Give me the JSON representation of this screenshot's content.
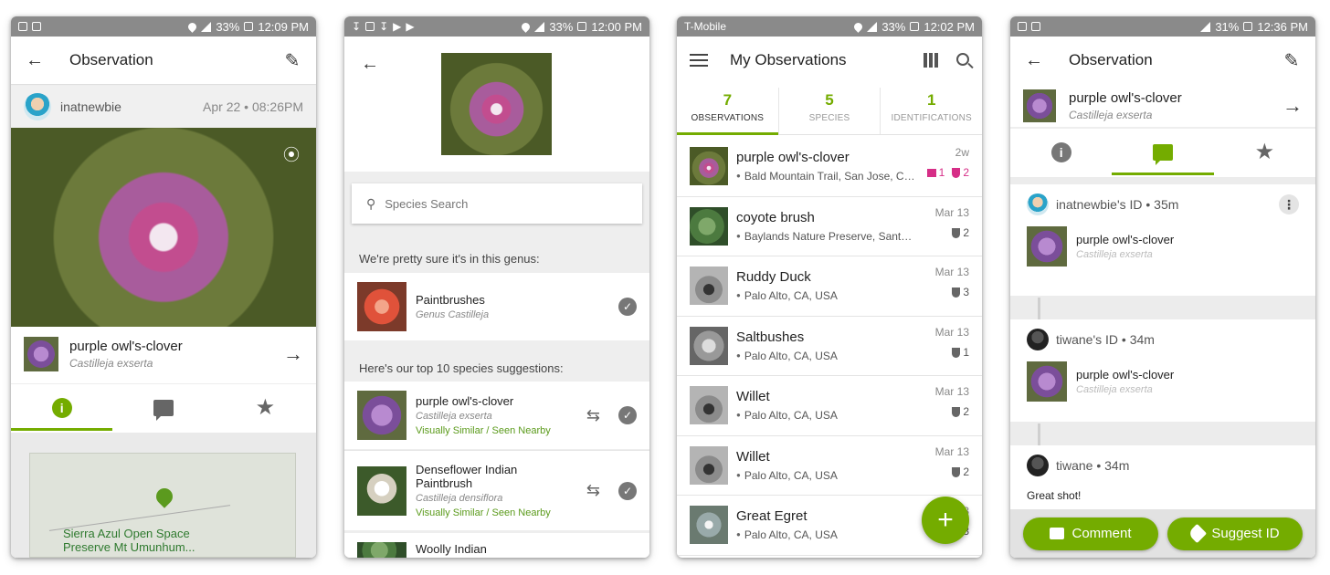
{
  "screen1": {
    "status": {
      "left_icons": [
        "image-icon",
        "gallery-icon"
      ],
      "battery": "33%",
      "time": "12:09 PM"
    },
    "appbar": {
      "title": "Observation"
    },
    "user": {
      "name": "inatnewbie",
      "date": "Apr 22 • 08:26PM"
    },
    "taxon": {
      "common": "purple owl's-clover",
      "scientific": "Castilleja exserta"
    },
    "tabs": [
      "info-icon",
      "comments-icon",
      "favorite-icon"
    ],
    "map": {
      "label_line1": "Sierra Azul Open Space",
      "label_line2": "Preserve Mt Umunhum..."
    }
  },
  "screen2": {
    "status": {
      "left_icons": [
        "download-icon",
        "image-icon",
        "download-icon",
        "play-icon",
        "play-icon"
      ],
      "battery": "33%",
      "time": "12:00 PM"
    },
    "search": {
      "placeholder": "Species Search"
    },
    "genus_heading": "We're pretty sure it's in this genus:",
    "genus": {
      "common": "Paintbrushes",
      "scientific": "Genus Castilleja"
    },
    "suggestions_heading": "Here's our top 10 species suggestions:",
    "suggestions": [
      {
        "common": "purple owl's-clover",
        "scientific": "Castilleja exserta",
        "tag": "Visually Similar / Seen Nearby"
      },
      {
        "common_line1": "Denseflower Indian",
        "common_line2": "Paintbrush",
        "scientific": "Castilleja densiflora",
        "tag": "Visually Similar / Seen Nearby"
      },
      {
        "common": "Woolly Indian"
      }
    ]
  },
  "screen3": {
    "status": {
      "carrier": "T-Mobile",
      "battery": "33%",
      "time": "12:02 PM"
    },
    "appbar": {
      "title": "My Observations"
    },
    "tabs": [
      {
        "count": "7",
        "label": "OBSERVATIONS"
      },
      {
        "count": "5",
        "label": "SPECIES"
      },
      {
        "count": "1",
        "label": "IDENTIFICATIONS"
      }
    ],
    "observations": [
      {
        "name": "purple owl's-clover",
        "place": "Bald Mountain Trail, San Jose, CA, USA",
        "when": "2w",
        "comments": "1",
        "ids": "2"
      },
      {
        "name": "coyote brush",
        "place": "Baylands Nature Preserve, Santa Clara, CA, USA",
        "when": "Mar 13",
        "ids": "2"
      },
      {
        "name": "Ruddy Duck",
        "place": "Palo Alto, CA, USA",
        "when": "Mar 13",
        "ids": "3"
      },
      {
        "name": "Saltbushes",
        "place": "Palo Alto, CA, USA",
        "when": "Mar 13",
        "ids": "1"
      },
      {
        "name": "Willet",
        "place": "Palo Alto, CA, USA",
        "when": "Mar 13",
        "ids": "2"
      },
      {
        "name": "Willet",
        "place": "Palo Alto, CA, USA",
        "when": "Mar 13",
        "ids": "2"
      },
      {
        "name": "Great Egret",
        "place": "Palo Alto, CA, USA",
        "when": "3",
        "ids": "3"
      }
    ],
    "fab": "+"
  },
  "screen4": {
    "status": {
      "left_icons": [
        "image-icon",
        "gallery-icon"
      ],
      "battery": "31%",
      "time": "12:36 PM"
    },
    "appbar": {
      "title": "Observation"
    },
    "taxon": {
      "common": "purple owl's-clover",
      "scientific": "Castilleja exserta"
    },
    "activity": [
      {
        "who": "inatnewbie's ID • 35m",
        "common": "purple owl's-clover",
        "scientific": "Castilleja exserta"
      },
      {
        "who": "tiwane's ID • 34m",
        "common": "purple owl's-clover",
        "scientific": "Castilleja exserta"
      },
      {
        "who": "tiwane • 34m",
        "comment": "Great shot!"
      }
    ],
    "actions": {
      "comment": "Comment",
      "suggest": "Suggest ID"
    }
  }
}
